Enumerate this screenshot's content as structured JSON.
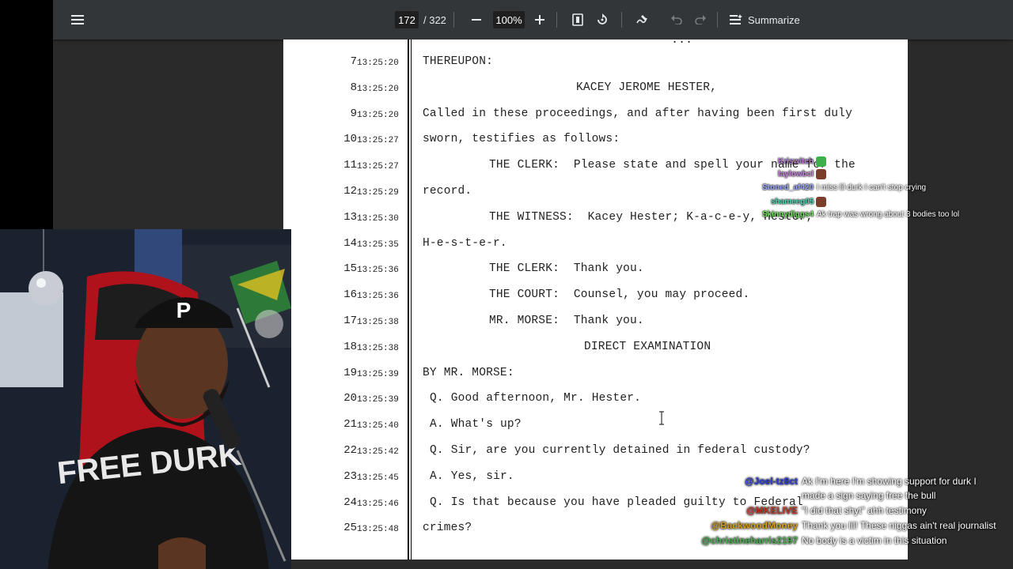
{
  "toolbar": {
    "current_page": "172",
    "page_separator": "/ 322",
    "zoom": "100%",
    "summarize_label": "Summarize"
  },
  "document": {
    "partial_top_text": "...",
    "lines": [
      {
        "num": "7",
        "ts": "13:25:20",
        "text": "THEREUPON:",
        "indent": 0
      },
      {
        "num": "8",
        "ts": "13:25:20",
        "text": "KACEY JEROME HESTER,",
        "indent": 2
      },
      {
        "num": "9",
        "ts": "13:25:20",
        "text": "Called in these proceedings, and after having been first duly",
        "indent": 0
      },
      {
        "num": "10",
        "ts": "13:25:27",
        "text": "sworn, testifies as follows:",
        "indent": 0
      },
      {
        "num": "11",
        "ts": "13:25:27",
        "text": "THE CLERK:  Please state and spell your name for the",
        "indent": 1
      },
      {
        "num": "12",
        "ts": "13:25:29",
        "text": "record.",
        "indent": 0
      },
      {
        "num": "13",
        "ts": "13:25:30",
        "text": "THE WITNESS:  Kacey Hester; K-a-c-e-y, Hester,",
        "indent": 1
      },
      {
        "num": "14",
        "ts": "13:25:35",
        "text": "H-e-s-t-e-r.",
        "indent": 0
      },
      {
        "num": "15",
        "ts": "13:25:36",
        "text": "THE CLERK:  Thank you.",
        "indent": 1
      },
      {
        "num": "16",
        "ts": "13:25:36",
        "text": "THE COURT:  Counsel, you may proceed.",
        "indent": 1
      },
      {
        "num": "17",
        "ts": "13:25:38",
        "text": "MR. MORSE:  Thank you.",
        "indent": 1
      },
      {
        "num": "18",
        "ts": "13:25:38",
        "text": "DIRECT EXAMINATION",
        "indent": 3
      },
      {
        "num": "19",
        "ts": "13:25:39",
        "text": "BY MR. MORSE:",
        "indent": 0
      },
      {
        "num": "20",
        "ts": "13:25:39",
        "text": "Q. Good afternoon, Mr. Hester.",
        "indent": 4
      },
      {
        "num": "21",
        "ts": "13:25:40",
        "text": "A. What's up?",
        "indent": 4
      },
      {
        "num": "22",
        "ts": "13:25:42",
        "text": "Q. Sir, are you currently detained in federal custody?",
        "indent": 4
      },
      {
        "num": "23",
        "ts": "13:25:45",
        "text": "A. Yes, sir.",
        "indent": 4
      },
      {
        "num": "24",
        "ts": "13:25:46",
        "text": "Q. Is that because you have pleaded guilty to Federal",
        "indent": 4
      },
      {
        "num": "25",
        "ts": "13:25:48",
        "text": "crimes?",
        "indent": 0
      }
    ]
  },
  "chat_top": [
    {
      "user": "Kriswitch",
      "msg": "",
      "color": "#b57ad8"
    },
    {
      "user": "laylowbcl",
      "msg": "",
      "color": "#c78ad8"
    },
    {
      "user": "Stoned_af420",
      "msg": "I miss lil durk I can't stop crying",
      "color": "#9aa8ff"
    },
    {
      "user": "shameeg05",
      "msg": "",
      "color": "#4fd6b0"
    },
    {
      "user": "Skinnydiggs4",
      "msg": "Ak trap was wrong about 3 bodies too lol",
      "color": "#74e062"
    }
  ],
  "chat_bottom": [
    {
      "user": "@Joel-tz8ct",
      "msg": "Ak I'm here I'm showing support for durk I",
      "color": "#2b3bd4"
    },
    {
      "user": "",
      "msg": "made a sign saying free the bull",
      "color": "#ffffff"
    },
    {
      "user": "@MKELIVE",
      "msg": "\"I did that shyt\" ahh testimony",
      "color": "#c0392b"
    },
    {
      "user": "@BackwoodMoney",
      "msg": "Thank you lil! These niggas ain't real journalist",
      "color": "#d4a017"
    },
    {
      "user": "@christineharris2197",
      "msg": "No body is a victim in this situation",
      "color": "#4caf50"
    }
  ],
  "webcam": {
    "shirt_text": "FREE DURK",
    "cap_letter": "P"
  },
  "colors": {
    "toolbar_bg": "#333639",
    "viewer_bg": "#2a2a2a",
    "page_bg": "#ffffff"
  }
}
